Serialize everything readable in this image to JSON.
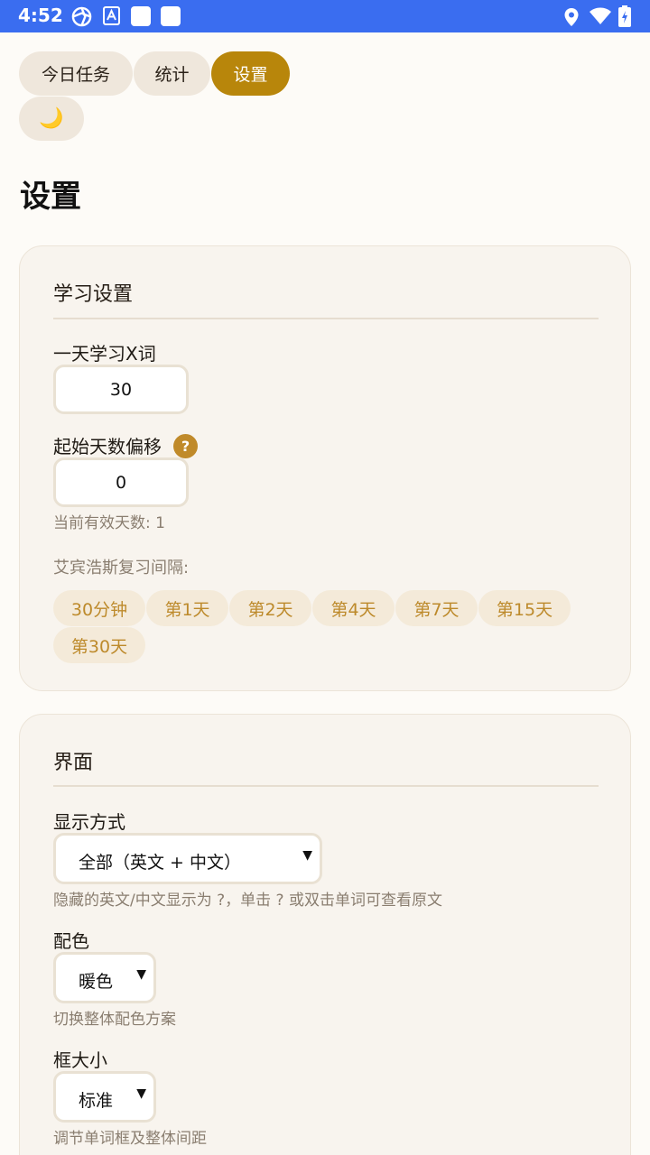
{
  "status_bar": {
    "time": "4:52"
  },
  "nav": {
    "tab_today": "今日任务",
    "tab_stats": "统计",
    "tab_settings": "设置",
    "theme_toggle": "🌙"
  },
  "page": {
    "title": "设置"
  },
  "study": {
    "section_title": "学习设置",
    "daily_words_label": "一天学习X词",
    "daily_words_value": "30",
    "offset_label": "起始天数偏移",
    "offset_help": "?",
    "offset_value": "0",
    "effective_days": "当前有效天数: 1",
    "ebbinghaus_label": "艾宾浩斯复习间隔:",
    "intervals": [
      "30分钟",
      "第1天",
      "第2天",
      "第4天",
      "第7天",
      "第15天",
      "第30天"
    ]
  },
  "interface": {
    "section_title": "界面",
    "display_label": "显示方式",
    "display_value": "全部（英文 + 中文）",
    "display_hint": "隐藏的英文/中文显示为 ?，单击 ? 或双击单词可查看原文",
    "color_label": "配色",
    "color_value": "暖色",
    "color_hint": "切换整体配色方案",
    "box_label": "框大小",
    "box_value": "标准",
    "box_hint": "调节单词框及整体间距"
  },
  "colors": {
    "accent": "#b8860b",
    "status_bar": "#3a6df0",
    "chip_text": "#bd8a2b"
  }
}
